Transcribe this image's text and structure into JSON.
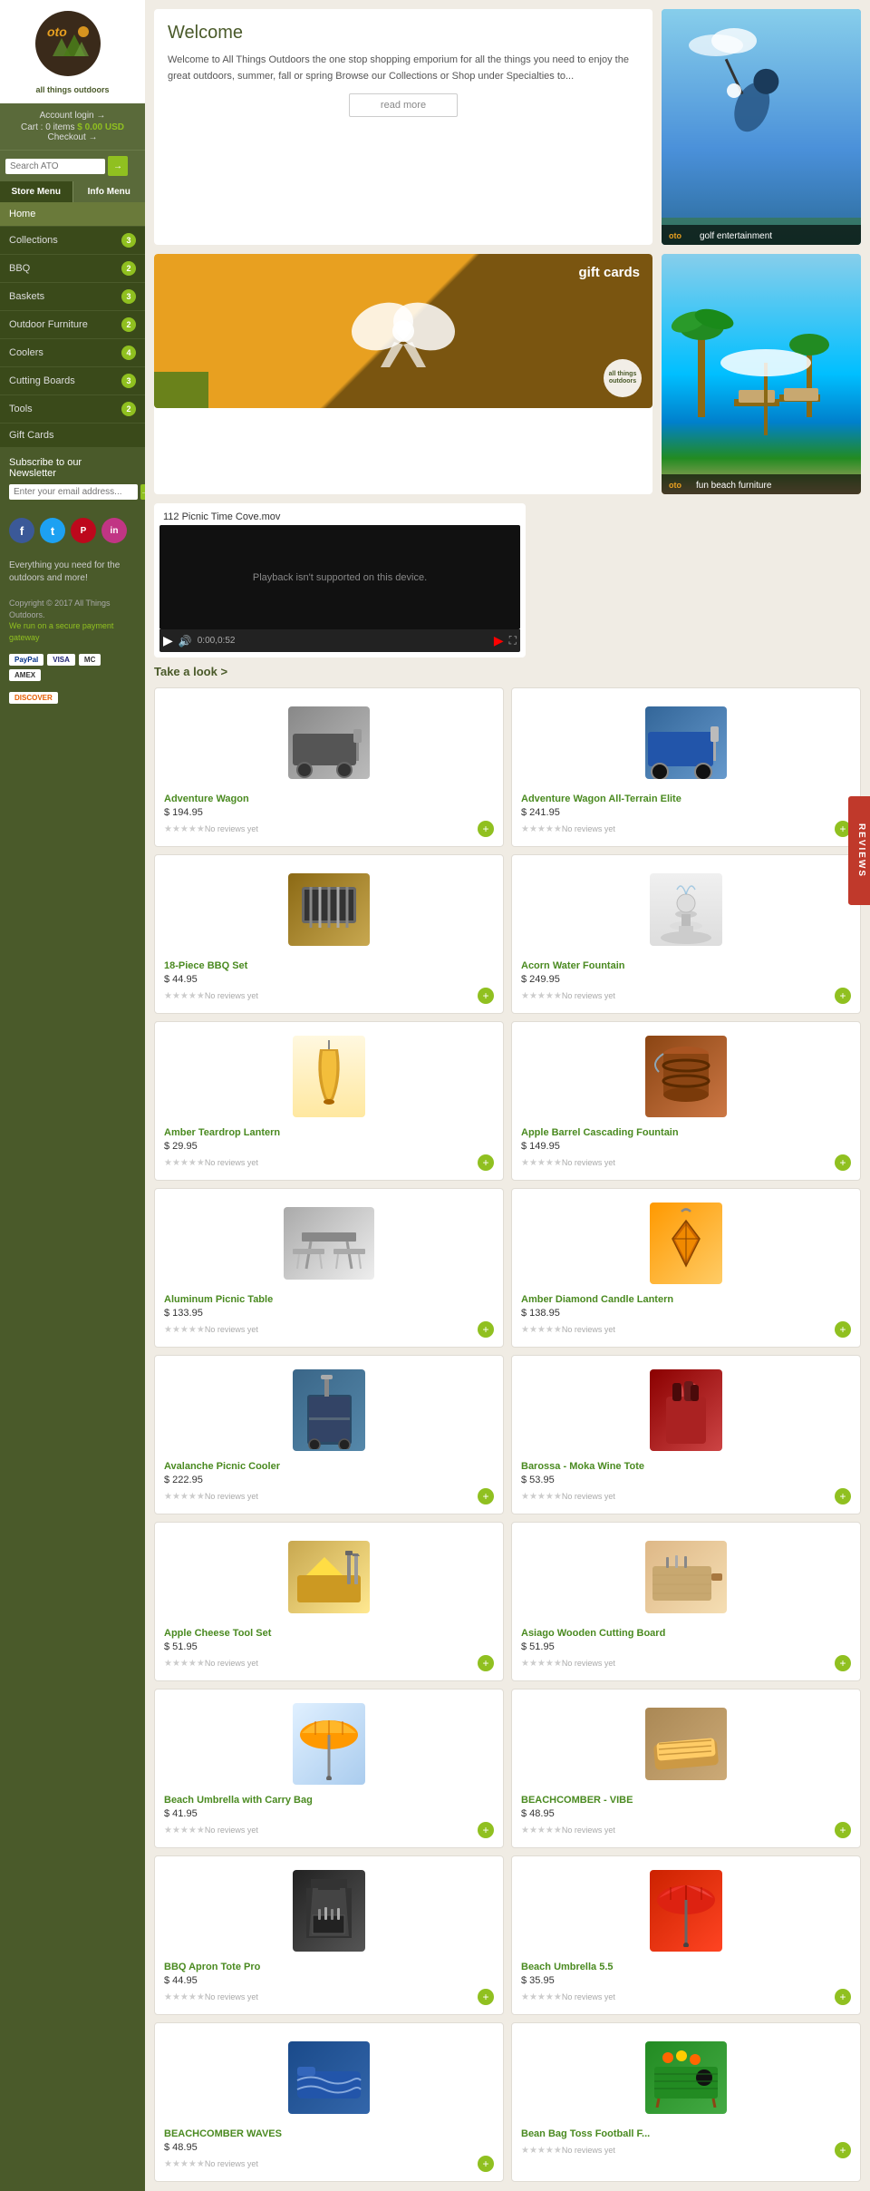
{
  "site": {
    "title": "all things outdoors",
    "tagline": "Everything you need for the outdoors and more!",
    "copyright": "Copyright © 2017 All Things Outdoors.",
    "payment_link": "We run on a secure payment gateway"
  },
  "logo": {
    "text": "oto",
    "subtitle": "all things outdoors"
  },
  "account": {
    "login_label": "Account login →",
    "cart_label": "Cart : 0 items",
    "cart_price": "$ 0.00 USD",
    "checkout_label": "Checkout →"
  },
  "search": {
    "placeholder": "Search ATO",
    "button_label": "→"
  },
  "menu_tabs": {
    "store": "Store Menu",
    "info": "Info Menu"
  },
  "nav_items": [
    {
      "label": "Home",
      "badge": null,
      "active": true
    },
    {
      "label": "Collections",
      "badge": "3",
      "active": false
    },
    {
      "label": "BBQ",
      "badge": "2",
      "active": false
    },
    {
      "label": "Baskets",
      "badge": "3",
      "active": false
    },
    {
      "label": "Outdoor Furniture",
      "badge": "2",
      "active": false
    },
    {
      "label": "Coolers",
      "badge": "4",
      "active": false
    },
    {
      "label": "Cutting Boards",
      "badge": "3",
      "active": false
    },
    {
      "label": "Tools",
      "badge": "2",
      "active": false
    },
    {
      "label": "Gift Cards",
      "badge": null,
      "active": false
    }
  ],
  "newsletter": {
    "label": "Subscribe to our",
    "label2": "Newsletter",
    "placeholder": "Enter your email address..."
  },
  "social": {
    "facebook": "f",
    "twitter": "t",
    "pinterest": "p",
    "instagram": "in"
  },
  "reviews_tab": "REVIEWS",
  "welcome": {
    "title": "Welcome",
    "text": "Welcome to All Things Outdoors the one stop shopping emporium for all the things you need to enjoy the great outdoors, summer, fall or spring Browse our Collections or Shop under Specialties to...",
    "read_more": "read more"
  },
  "golf": {
    "label": "golf entertainment",
    "ato_logo": "oto"
  },
  "gift_cards": {
    "label": "gift cards"
  },
  "beach": {
    "label": "fun beach furniture",
    "ato_logo": "oto"
  },
  "video": {
    "title": "112 Picnic Time Cove.mov",
    "playback_text": "Playback isn't supported on this device.",
    "time": "0:00,0:52"
  },
  "take_look": {
    "label": "Take a look >"
  },
  "products": [
    {
      "name": "Adventure Wagon",
      "price": "$ 194.95",
      "reviews": "No reviews yet",
      "color": "#5a8a3a"
    },
    {
      "name": "Adventure Wagon All-Terrain Elite",
      "price": "$ 241.95",
      "reviews": "No reviews yet",
      "color": "#5a8a3a"
    },
    {
      "name": "18-Piece BBQ Set",
      "price": "$ 44.95",
      "reviews": "No reviews yet",
      "color": "#5a8a3a"
    },
    {
      "name": "Acorn Water Fountain",
      "price": "$ 249.95",
      "reviews": "No reviews yet",
      "color": "#5a8a3a"
    },
    {
      "name": "Amber Teardrop Lantern",
      "price": "$ 29.95",
      "reviews": "No reviews yet",
      "color": "#5a8a3a"
    },
    {
      "name": "Apple Barrel Cascading Fountain",
      "price": "$ 149.95",
      "reviews": "No reviews yet",
      "color": "#5a8a3a"
    },
    {
      "name": "Aluminum Picnic Table",
      "price": "$ 133.95",
      "reviews": "No reviews yet",
      "color": "#5a8a3a"
    },
    {
      "name": "Amber Diamond Candle Lantern",
      "price": "$ 138.95",
      "reviews": "No reviews yet",
      "color": "#5a8a3a"
    },
    {
      "name": "Avalanche Picnic Cooler",
      "price": "$ 222.95",
      "reviews": "No reviews yet",
      "color": "#5a8a3a"
    },
    {
      "name": "Barossa - Moka Wine Tote",
      "price": "$ 53.95",
      "reviews": "No reviews yet",
      "color": "#5a8a3a"
    },
    {
      "name": "Apple Cheese Tool Set",
      "price": "$ 51.95",
      "reviews": "No reviews yet",
      "color": "#5a8a3a"
    },
    {
      "name": "Asiago Wooden Cutting Board",
      "price": "$ 51.95",
      "reviews": "No reviews yet",
      "color": "#5a8a3a"
    },
    {
      "name": "Beach Umbrella with Carry Bag",
      "price": "$ 41.95",
      "reviews": "No reviews yet",
      "color": "#5a8a3a"
    },
    {
      "name": "BEACHCOMBER - VIBE",
      "price": "$ 48.95",
      "reviews": "No reviews yet",
      "color": "#5a8a3a"
    },
    {
      "name": "BBQ Apron Tote Pro",
      "price": "$ 44.95",
      "reviews": "No reviews yet",
      "color": "#5a8a3a"
    },
    {
      "name": "Beach Umbrella 5.5",
      "price": "$ 35.95",
      "reviews": "No reviews yet",
      "color": "#5a8a3a"
    },
    {
      "name": "BEACHCOMBER WAVES",
      "price": "$ 48.95",
      "reviews": "No reviews yet",
      "color": "#5a8a3a"
    },
    {
      "name": "Bean Bag Toss Football F...",
      "price": "",
      "reviews": "No reviews yet",
      "color": "#5a8a3a"
    }
  ],
  "payment_methods": [
    "PayPal",
    "VISA",
    "MC",
    "AMEX",
    "DISCOVER"
  ]
}
